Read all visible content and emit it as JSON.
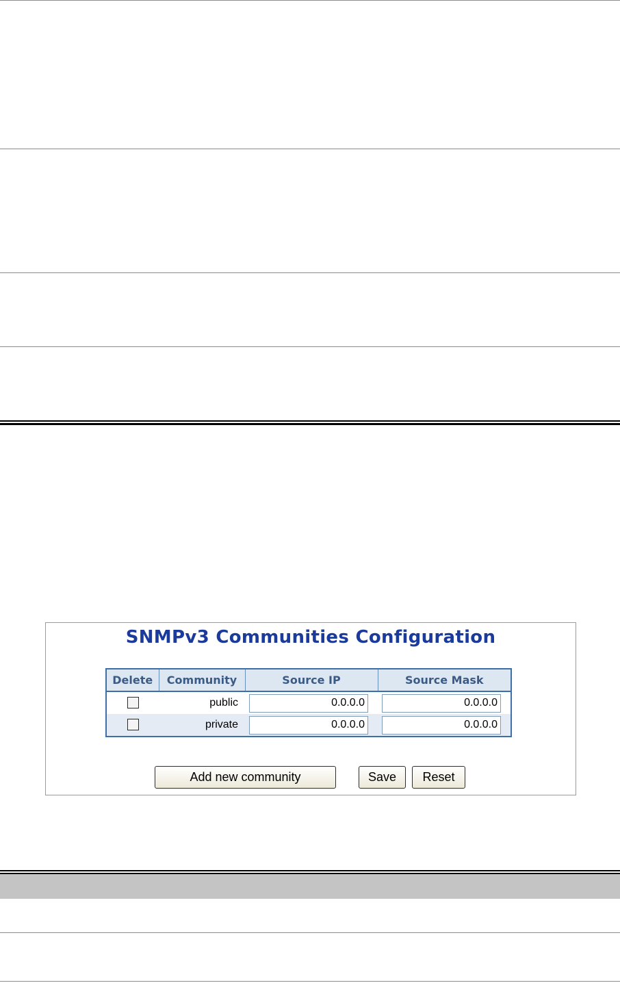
{
  "panel": {
    "title": "SNMPv3 Communities Configuration",
    "columns": [
      "Delete",
      "Community",
      "Source IP",
      "Source Mask"
    ],
    "rows": [
      {
        "community": "public",
        "source_ip": "0.0.0.0",
        "source_mask": "0.0.0.0"
      },
      {
        "community": "private",
        "source_ip": "0.0.0.0",
        "source_mask": "0.0.0.0"
      }
    ],
    "buttons": {
      "add": "Add new community",
      "save": "Save",
      "reset": "Reset"
    }
  },
  "colors": {
    "title": "#1a3a9c",
    "header_bg": "#dde7f2",
    "table_border": "#3d6fa6",
    "alt_row": "#e4ebf4"
  }
}
